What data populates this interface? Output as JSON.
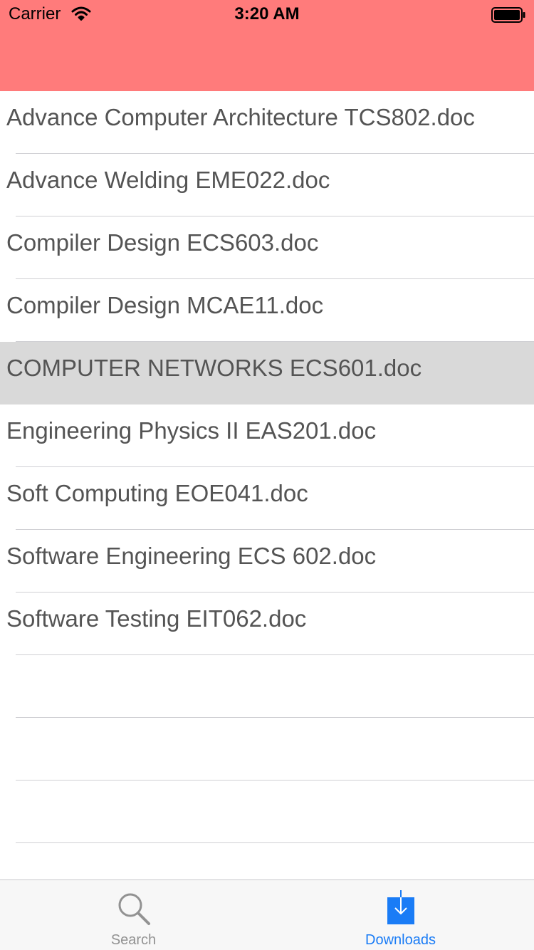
{
  "status_bar": {
    "carrier": "Carrier",
    "time": "3:20 AM"
  },
  "colors": {
    "header": "#ff7b7b",
    "selected_row": "#d9d9d9",
    "tab_active": "#1a7cf6",
    "tab_inactive": "#929292"
  },
  "list": {
    "items": [
      {
        "label": "Advance Computer Architecture TCS802.doc"
      },
      {
        "label": "Advance Welding EME022.doc"
      },
      {
        "label": "Compiler Design ECS603.doc"
      },
      {
        "label": "Compiler Design MCAE11.doc"
      },
      {
        "label": "COMPUTER NETWORKS ECS601.doc"
      },
      {
        "label": "Engineering Physics II EAS201.doc"
      },
      {
        "label": "Soft Computing EOE041.doc"
      },
      {
        "label": "Software Engineering ECS 602.doc"
      },
      {
        "label": "Software Testing EIT062.doc"
      }
    ],
    "selected_index": 4
  },
  "tabbar": {
    "search": {
      "label": "Search",
      "icon": "magnifier-icon"
    },
    "downloads": {
      "label": "Downloads",
      "icon": "download-icon"
    }
  }
}
